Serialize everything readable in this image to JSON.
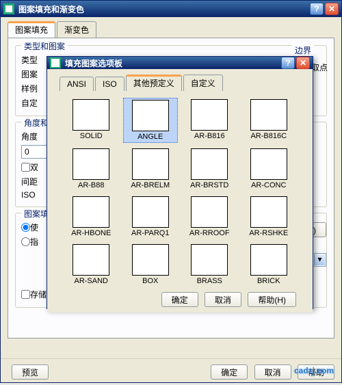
{
  "main_window": {
    "title": "图案填充和渐变色",
    "tabs": {
      "fill": "图案填充",
      "gradient": "渐变色"
    },
    "type_group": {
      "legend": "类型和图案",
      "type_label": "类型",
      "pattern_label": "图案",
      "sample_label": "样例",
      "custom_label": "自定"
    },
    "angle_group": {
      "legend": "角度和",
      "angle_label": "角度",
      "angle_value": "0",
      "double_label": "双",
      "spacing_label": "间距",
      "iso_label": "ISO"
    },
    "origin_group": {
      "legend": "图案填",
      "opt_use": "使",
      "opt_spec": "指",
      "store_default": "存储为默认原点"
    },
    "boundary": {
      "legend": "边界",
      "add_pick": "添加:拾取点"
    },
    "refill_btn": "充 (H)",
    "footer": {
      "preview": "预览",
      "ok": "确定",
      "cancel": "取消",
      "help": "帮助"
    }
  },
  "palette_window": {
    "title": "填充图案选项板",
    "tabs": {
      "ansi": "ANSI",
      "iso": "ISO",
      "other": "其他预定义",
      "custom": "自定义"
    },
    "active_tab": "other",
    "selected_index": 1,
    "swatches": [
      {
        "name": "SOLID",
        "cls": "p-solid"
      },
      {
        "name": "ANGLE",
        "cls": "p-angle"
      },
      {
        "name": "AR-B816",
        "cls": "p-b816"
      },
      {
        "name": "AR-B816C",
        "cls": "p-b816c"
      },
      {
        "name": "AR-B88",
        "cls": "p-b88"
      },
      {
        "name": "AR-BRELM",
        "cls": "p-brelm"
      },
      {
        "name": "AR-BRSTD",
        "cls": "p-brstd"
      },
      {
        "name": "AR-CONC",
        "cls": "p-conc"
      },
      {
        "name": "AR-HBONE",
        "cls": "p-hbone"
      },
      {
        "name": "AR-PARQ1",
        "cls": "p-parq1"
      },
      {
        "name": "AR-RROOF",
        "cls": "p-rroof"
      },
      {
        "name": "AR-RSHKE",
        "cls": "p-rshke"
      },
      {
        "name": "AR-SAND",
        "cls": "p-sand"
      },
      {
        "name": "BOX",
        "cls": "p-box"
      },
      {
        "name": "BRASS",
        "cls": "p-brass"
      },
      {
        "name": "BRICK",
        "cls": "p-brick"
      }
    ],
    "footer": {
      "ok": "确定",
      "cancel": "取消",
      "help": "帮助(H)"
    }
  },
  "watermark": "cadzj.com"
}
